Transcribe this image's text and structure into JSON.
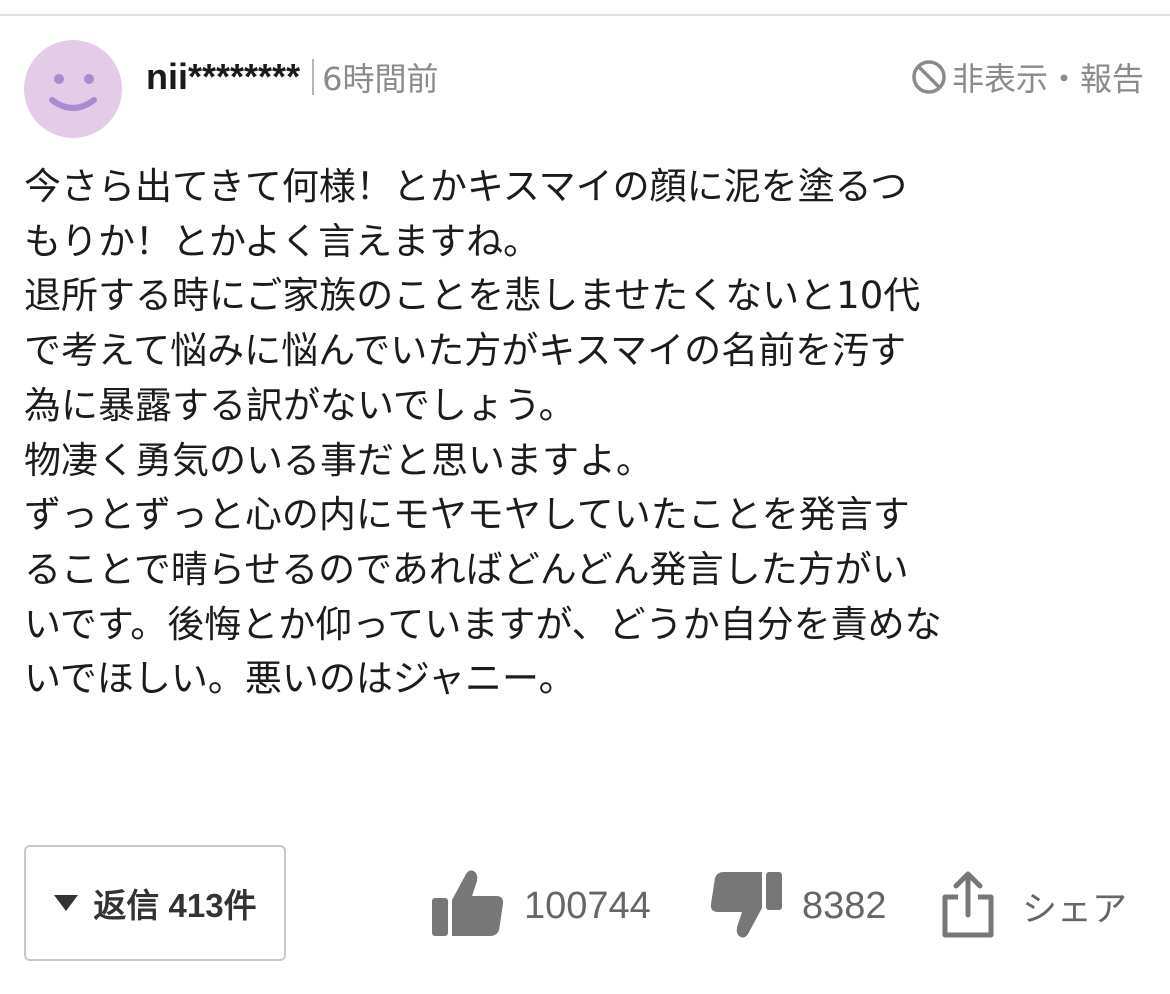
{
  "comment": {
    "username": "nii********",
    "time": "6時間前",
    "hide_report_label": "非表示・報告",
    "body_lines": [
      "今さら出てきて何様！とかキスマイの顔に泥を塗るつ",
      "もりか！とかよく言えますね。",
      "退所する時にご家族のことを悲しませたくないと10代",
      "で考えて悩みに悩んでいた方がキスマイの名前を汚す",
      "為に暴露する訳がないでしょう。",
      "物凄く勇気のいる事だと思いますよ。",
      "ずっとずっと心の内にモヤモヤしていたことを発言す",
      "ることで晴らせるのであればどんどん発言した方がい",
      "いです。後悔とか仰っていますが、どうか自分を責めな",
      "いでほしい。悪いのはジャニー。"
    ]
  },
  "actions": {
    "reply_label": "返信 413件",
    "like_count": "100744",
    "dislike_count": "8382",
    "share_label": "シェア"
  },
  "icons": {
    "avatar": "smiley-face-icon",
    "hide": "ban-icon",
    "reply": "triangle-down-icon",
    "like": "thumbs-up-icon",
    "dislike": "thumbs-down-icon",
    "share": "share-icon"
  },
  "colors": {
    "avatar_bg": "#e4cbe8",
    "avatar_face": "#a98bd0",
    "muted_text": "#8b8b8b",
    "icon_gray": "#777777"
  }
}
